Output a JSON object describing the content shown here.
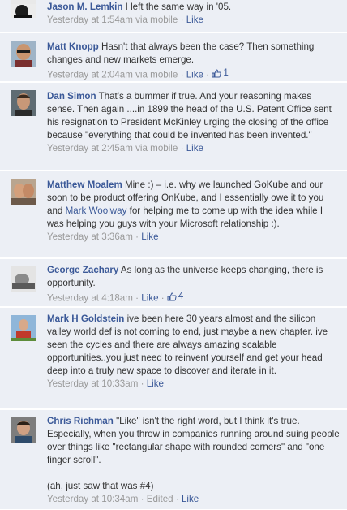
{
  "comments": [
    {
      "author": "Jason M. Lemkin",
      "text": "I left the same way in '05.",
      "time": "Yesterday at 1:54am via mobile",
      "like_label": "Like"
    },
    {
      "author": "Matt Knopp",
      "text": "Hasn't that always been the case? Then something changes and new markets emerge.",
      "time": "Yesterday at 2:04am via mobile",
      "like_label": "Like",
      "like_count": "1"
    },
    {
      "author": "Dan Simon",
      "text": "That's a bummer if true. And your reasoning makes sense. Then again ....in 1899 the head of the U.S. Patent Office sent his resignation to President McKinley urging the closing of the office because \"everything that could be invented has been invented.\"",
      "time": "Yesterday at 2:45am via mobile",
      "like_label": "Like"
    },
    {
      "author": "Matthew Moalem",
      "text_before": "Mine :) – i.e. why we launched GoKube and our soon to be product offering OnKube, and I essentially owe it to you and ",
      "mention": "Mark Woolway",
      "text_after": " for helping me to come up with the idea while I was helping you guys with your Microsoft relationship :).",
      "time": "Yesterday at 3:36am",
      "like_label": "Like"
    },
    {
      "author": "George Zachary",
      "text": "As long as the universe keeps changing, there is opportunity.",
      "time": "Yesterday at 4:18am",
      "like_label": "Like",
      "like_count": "4"
    },
    {
      "author": "Mark H Goldstein",
      "text": "ive been here 30 years almost and the silicon valley world def is not coming to end, just maybe a new chapter. ive seen the cycles and there are always amazing scalable opportunities..you just need to reinvent yourself and get your head deep into a truly new space to discover and iterate in it.",
      "time": "Yesterday at 10:33am",
      "like_label": "Like"
    },
    {
      "author": "Chris Richman",
      "text": "\"Like\" isn't the right word, but I think it's true. Especially, when you throw in companies running around suing people over things like \"rectangular shape with rounded corners\" and \"one finger scroll\".",
      "text2": "(ah, just saw that was #4)",
      "time": "Yesterday at 10:34am",
      "edited": "Edited",
      "like_label": "Like"
    }
  ],
  "colors": {
    "background": "#eceff5",
    "link": "#3b5998",
    "meta": "#999999",
    "text": "#333333"
  }
}
